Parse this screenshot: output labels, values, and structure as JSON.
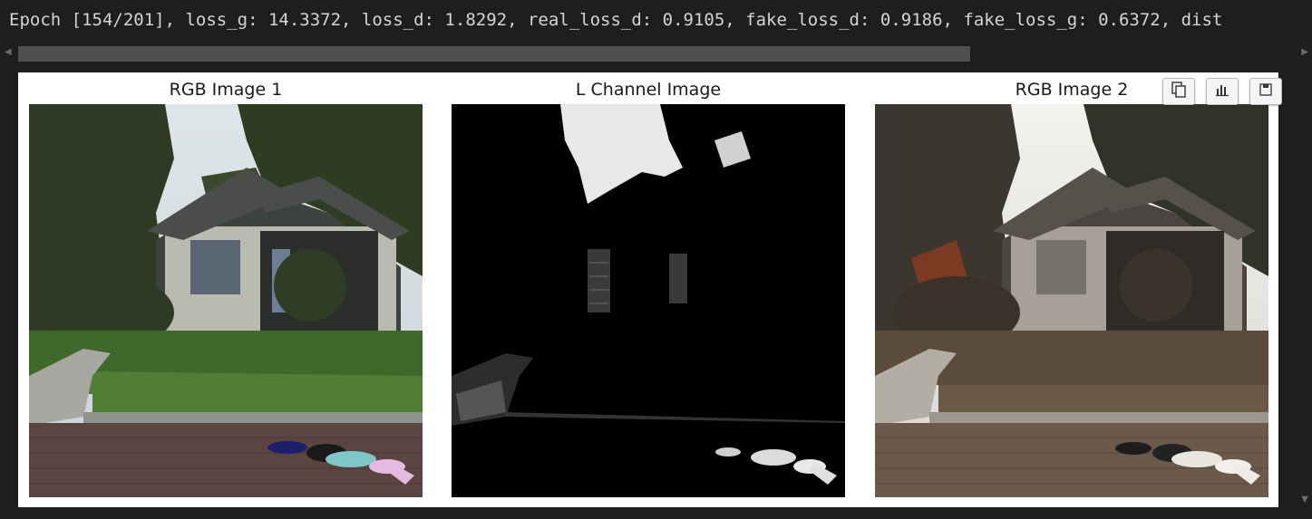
{
  "output": {
    "log_line": "Epoch [154/201], loss_g: 14.3372, loss_d: 1.8292, real_loss_d: 0.9105, fake_loss_d: 0.9186, fake_loss_g: 0.6372, dist"
  },
  "figure": {
    "panels": [
      {
        "title": "RGB Image 1"
      },
      {
        "title": "L Channel Image"
      },
      {
        "title": "RGB Image 2"
      }
    ],
    "toolbar": {
      "icons": [
        "copy-icon",
        "chart-icon",
        "save-icon"
      ]
    }
  }
}
